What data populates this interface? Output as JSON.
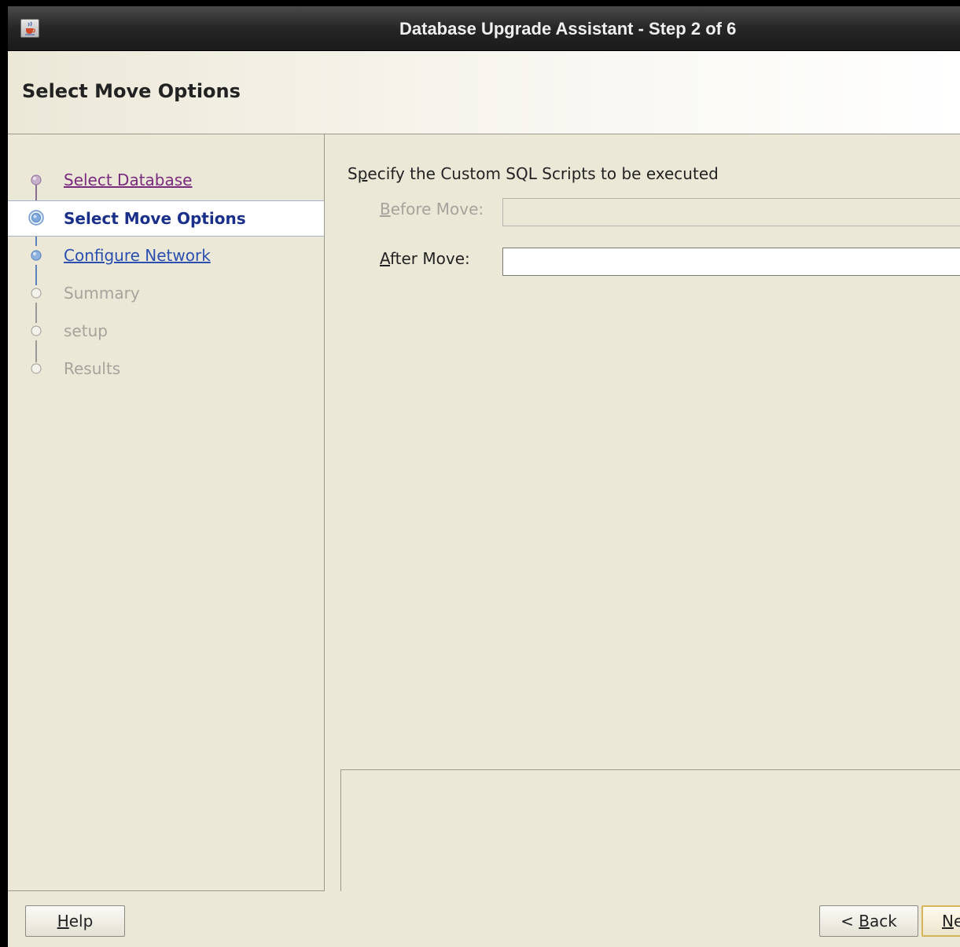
{
  "window": {
    "title": "Database Upgrade Assistant - Step 2 of 6",
    "icon": "java-cup-icon"
  },
  "header": {
    "title": "Select Move Options"
  },
  "steps": [
    {
      "label": "Select Database",
      "state": "visited"
    },
    {
      "label": "Select Move Options",
      "state": "current"
    },
    {
      "label": "Configure Network",
      "state": "link"
    },
    {
      "label": "Summary",
      "state": "disabled"
    },
    {
      "label": "setup",
      "state": "disabled"
    },
    {
      "label": "Results",
      "state": "disabled"
    }
  ],
  "content": {
    "instruction_pre": "S",
    "instruction_mn": "p",
    "instruction_post": "ecify the Custom SQL Scripts to be executed",
    "before_move": {
      "mnemonic": "B",
      "label_rest": "efore Move:",
      "value": "",
      "enabled": false
    },
    "after_move": {
      "mnemonic": "A",
      "label_rest": "fter Move:",
      "value": "",
      "enabled": true
    }
  },
  "footer": {
    "help": {
      "mnemonic": "H",
      "rest": "elp"
    },
    "back": {
      "prefix": "< ",
      "mnemonic": "B",
      "rest": "ack"
    },
    "next": {
      "mnemonic": "N",
      "rest": "ext >"
    }
  },
  "colors": {
    "visited_step": "#7a2a7e",
    "link_step": "#2a4fb0",
    "current_step": "#1a2f8a",
    "disabled_text": "#a4a39c",
    "background": "#ece8d8"
  }
}
